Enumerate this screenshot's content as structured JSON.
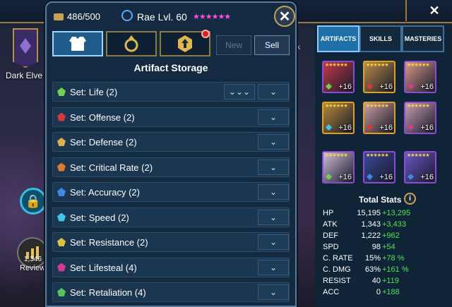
{
  "background": {
    "faction_label": "Dark Elve",
    "review_count": "1,346",
    "review_label": "Review"
  },
  "panel": {
    "storage_count": "486/500",
    "champion_name": "Rae Lvl. 60",
    "stars": "★★★★★★",
    "close_icon": "✕",
    "new_label": "New",
    "sell_label": "Sell",
    "title": "Artifact Storage"
  },
  "sets": [
    {
      "label": "Set: Life (2)",
      "icon_color": "#6fd14b",
      "first": "⌄⌄⌄",
      "second": "⌄"
    },
    {
      "label": "Set: Offense (2)",
      "icon_color": "#d43a3a",
      "first": "",
      "second": "⌄"
    },
    {
      "label": "Set: Defense (2)",
      "icon_color": "#d9b04a",
      "first": "",
      "second": "⌄"
    },
    {
      "label": "Set: Critical Rate (2)",
      "icon_color": "#e07a2c",
      "first": "",
      "second": "⌄"
    },
    {
      "label": "Set: Accuracy (2)",
      "icon_color": "#3a8be0",
      "first": "",
      "second": "⌄"
    },
    {
      "label": "Set: Speed (2)",
      "icon_color": "#3cc7e8",
      "first": "",
      "second": "⌄"
    },
    {
      "label": "Set: Resistance (2)",
      "icon_color": "#e0c23a",
      "first": "",
      "second": "⌄"
    },
    {
      "label": "Set: Lifesteal (4)",
      "icon_color": "#d43a8e",
      "first": "",
      "second": "⌄"
    },
    {
      "label": "Set: Retaliation (4)",
      "icon_color": "#56c456",
      "first": "",
      "second": "⌄"
    }
  ],
  "right": {
    "tabs": [
      "ARTIFACTS",
      "SKILLS",
      "MASTERIES"
    ],
    "artifacts": [
      {
        "level": "+16",
        "bg": "#c23a4a",
        "frame": "#8c4bd6",
        "mark": "#6fd14b"
      },
      {
        "level": "+16",
        "bg": "#b98d4a",
        "frame": "#e0a020",
        "mark": "#d43a3a"
      },
      {
        "level": "+16",
        "bg": "#d89a8a",
        "frame": "#8c4bd6",
        "mark": "#d43a8e"
      },
      {
        "level": "+16",
        "bg": "#b58a3a",
        "frame": "#e0a020",
        "mark": "#3cc7e8"
      },
      {
        "level": "+16",
        "bg": "#c9a0a0",
        "frame": "#e0a020",
        "mark": "#d43a3a"
      },
      {
        "level": "+16",
        "bg": "#c8a0b0",
        "frame": "#8c4bd6",
        "mark": "#d43a8e"
      },
      {
        "level": "+16",
        "bg": "#d0c0d8",
        "frame": "#8c4bd6",
        "mark": "#6fd14b"
      },
      {
        "level": "+16",
        "bg": "#3a4a9a",
        "frame": "#8c4bd6",
        "mark": "#3a8be0"
      },
      {
        "level": "+16",
        "bg": "#6a58c8",
        "frame": "#8c4bd6",
        "mark": "#3a8be0"
      }
    ],
    "total_title": "Total Stats",
    "info_icon": "i",
    "stats": [
      {
        "name": "HP",
        "base": "15,195",
        "bonus": "+13,295"
      },
      {
        "name": "ATK",
        "base": "1,343",
        "bonus": "+3,433"
      },
      {
        "name": "DEF",
        "base": "1,222",
        "bonus": "+962"
      },
      {
        "name": "SPD",
        "base": "98",
        "bonus": "+54"
      },
      {
        "name": "C. RATE",
        "base": "15%",
        "bonus": "+78 %"
      },
      {
        "name": "C. DMG",
        "base": "63%",
        "bonus": "+161 %"
      },
      {
        "name": "RESIST",
        "base": "40",
        "bonus": "+119"
      },
      {
        "name": "ACC",
        "base": "0",
        "bonus": "+188"
      }
    ]
  }
}
